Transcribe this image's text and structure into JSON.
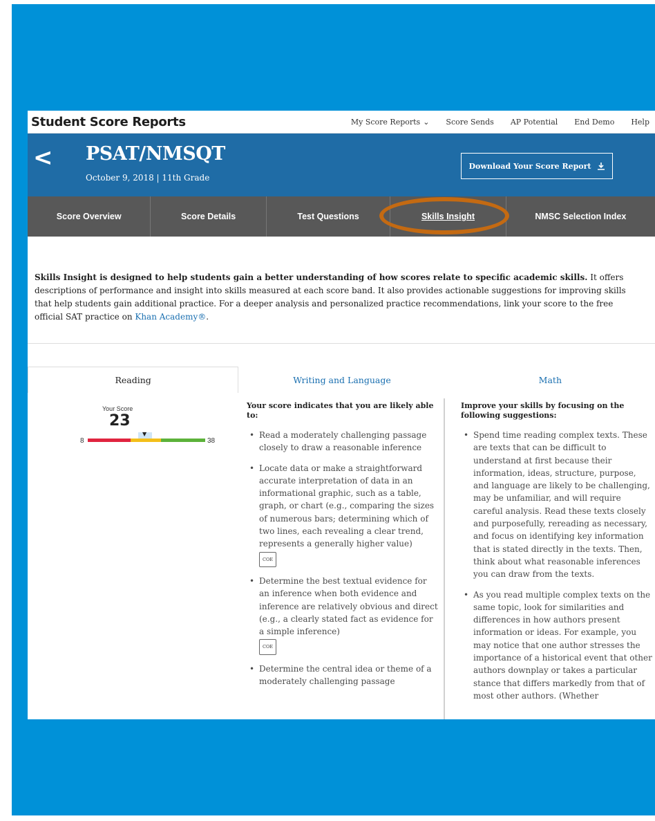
{
  "app": {
    "title": "Student Score Reports"
  },
  "topnav": {
    "items": [
      "My Score Reports",
      "Score Sends",
      "AP Potential",
      "End Demo",
      "Help"
    ]
  },
  "hero": {
    "back_label": "<",
    "title": "PSAT/NMSQT",
    "subtitle": "October 9, 2018  |  11th Grade",
    "download_label": "Download Your Score Report"
  },
  "tabs": [
    {
      "label": "Score Overview"
    },
    {
      "label": "Score Details"
    },
    {
      "label": "Test Questions"
    },
    {
      "label": "Skills Insight",
      "active": true
    },
    {
      "label": "NMSC Selection Index"
    }
  ],
  "intro": {
    "bold": "Skills Insight is designed to help students gain a better understanding of how scores relate to specific academic skills.",
    "text": " It offers descriptions of performance and insight into skills measured at each score band. It also provides actionable suggestions for improving skills that help students gain additional practice. For a deeper analysis and personalized practice recommendations, link your score to the free official SAT practice on ",
    "link": "Khan Academy®",
    "end": "."
  },
  "subtabs": [
    {
      "label": "Reading",
      "active": true
    },
    {
      "label": "Writing and Language"
    },
    {
      "label": "Math"
    }
  ],
  "score": {
    "label": "Your Score",
    "value": "23",
    "min": "8",
    "max": "38",
    "value_fraction": 0.5
  },
  "likely": {
    "heading": "Your score indicates that you are likely able to:",
    "items": [
      {
        "text": "Read a moderately challenging passage closely to draw a reasonable inference"
      },
      {
        "text": "Locate data or make a straightforward accurate interpretation of data in an informational graphic, such as a table, graph, or chart (e.g., comparing the sizes of numerous bars; determining which of two lines, each revealing a clear trend, represents a generally higher value)",
        "tag": "COE"
      },
      {
        "text": "Determine the best textual evidence for an inference when both evidence and inference are relatively obvious and direct (e.g., a clearly stated fact as evidence for a simple inference)",
        "tag": "COE"
      },
      {
        "text": "Determine the central idea or theme of a moderately challenging passage"
      }
    ]
  },
  "suggest": {
    "heading": "Improve your skills by focusing on the following suggestions:",
    "items": [
      {
        "text": "Spend time reading complex texts. These are texts that can be difficult to understand at first because their information, ideas, structure, purpose, and language are likely to be challenging, may be unfamiliar, and will require careful analysis. Read these texts closely and purposefully, rereading as necessary, and focus on identifying key information that is stated directly in the texts. Then, think about what reasonable inferences you can draw from the texts."
      },
      {
        "text": "As you read multiple complex texts on the same topic, look for similarities and differences in how authors present information or ideas. For example, you may notice that one author stresses the importance of a historical event that other authors downplay or takes a particular stance that differs markedly from that of most other authors. (Whether"
      }
    ]
  },
  "colors": {
    "frame": "#0091d8",
    "hero": "#1f6ca6",
    "tabs": "#585858",
    "highlight": "#c46a12",
    "link": "#1a6fb0",
    "bar_red": "#e0243f",
    "bar_yellow": "#f3bf1a",
    "bar_green": "#5cb23a"
  },
  "icons": {
    "menu_chevron": "chevron-down-icon",
    "download": "download-icon",
    "back": "chevron-left-icon"
  }
}
